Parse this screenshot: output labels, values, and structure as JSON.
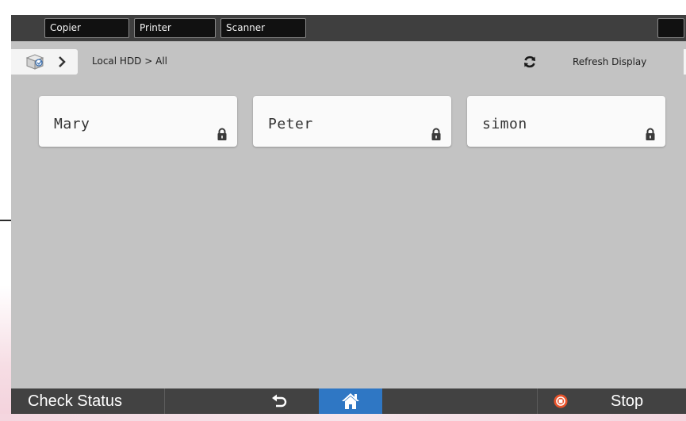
{
  "app_bar": {
    "tabs": [
      {
        "label": "Copier"
      },
      {
        "label": "Printer"
      },
      {
        "label": "Scanner"
      }
    ]
  },
  "breadcrumb": {
    "path": "Local HDD > All",
    "refresh_label": "Refresh Display"
  },
  "users": [
    {
      "name": "Mary",
      "locked": true
    },
    {
      "name": "Peter",
      "locked": true
    },
    {
      "name": "simon",
      "locked": true
    }
  ],
  "system_bar": {
    "check_status_label": "Check Status",
    "stop_label": "Stop"
  },
  "colors": {
    "screen_bg": "#c3c3c3",
    "home_button": "#2f77c4",
    "stop_icon": "#e8532b"
  }
}
